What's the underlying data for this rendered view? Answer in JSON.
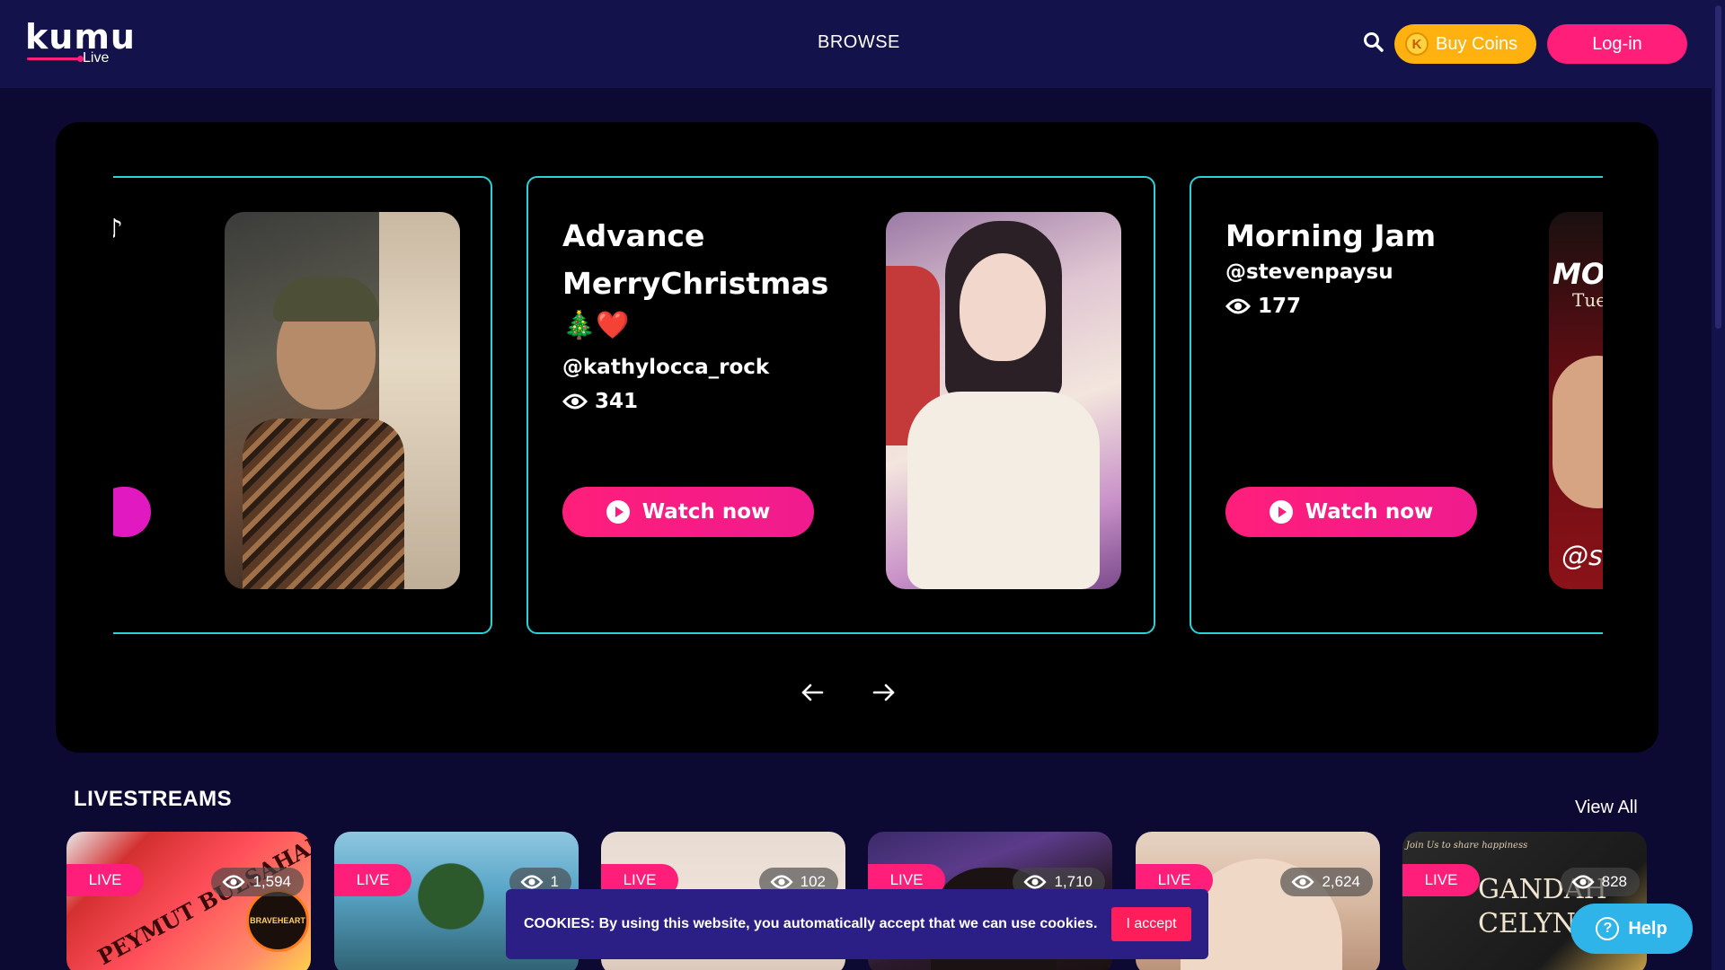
{
  "brand": {
    "logo_word": "kumu",
    "logo_sub": "Live"
  },
  "header": {
    "nav_browse": "BROWSE",
    "search_icon": "search-icon",
    "buy_coins_label": "Buy Coins",
    "coin_glyph": "K",
    "login_label": "Log-in"
  },
  "colors": {
    "background": "#0c0a33",
    "header": "#14124a",
    "accent_pink": "#ff1e7a",
    "coin_yellow": "#ffb20f",
    "card_border": "#2bd3d6",
    "cookie_bg": "#2b1f86",
    "help_blue": "#2fb4e9"
  },
  "featured": {
    "cards": [
      {
        "title_fragment": "♪",
        "watch_label": ""
      },
      {
        "title": "Advance MerryChristmas",
        "emoji": "🎄❤️",
        "handle": "@kathylocca_rock",
        "views": "341",
        "watch_label": "Watch now"
      },
      {
        "title": "Morning Jam",
        "handle": "@stevenpaysu",
        "views": "177",
        "watch_label": "Watch now",
        "thumb_text_top": "MO",
        "thumb_text_mid": "Tue",
        "thumb_text_bottom": "@s"
      }
    ],
    "prev_icon": "arrow-left-icon",
    "next_icon": "arrow-right-icon"
  },
  "livestreams": {
    "title": "LIVESTREAMS",
    "view_all": "View All",
    "badge": "LIVE",
    "items": [
      {
        "viewers": "1,594",
        "overlay_text": "PEYMUT BULSAHAN",
        "sticker": "BRAVEHEART"
      },
      {
        "viewers": "1"
      },
      {
        "viewers": "102"
      },
      {
        "viewers": "1,710"
      },
      {
        "viewers": "2,624"
      },
      {
        "viewers": "828",
        "overlay_text": "GANDAH CELYN",
        "overlay_small": "Join Us to share happiness"
      }
    ]
  },
  "cookie": {
    "text": "COOKIES: By using this website, you automatically accept that we can use cookies.",
    "accept_label": "I accept"
  },
  "help": {
    "label": "Help",
    "glyph": "?"
  }
}
